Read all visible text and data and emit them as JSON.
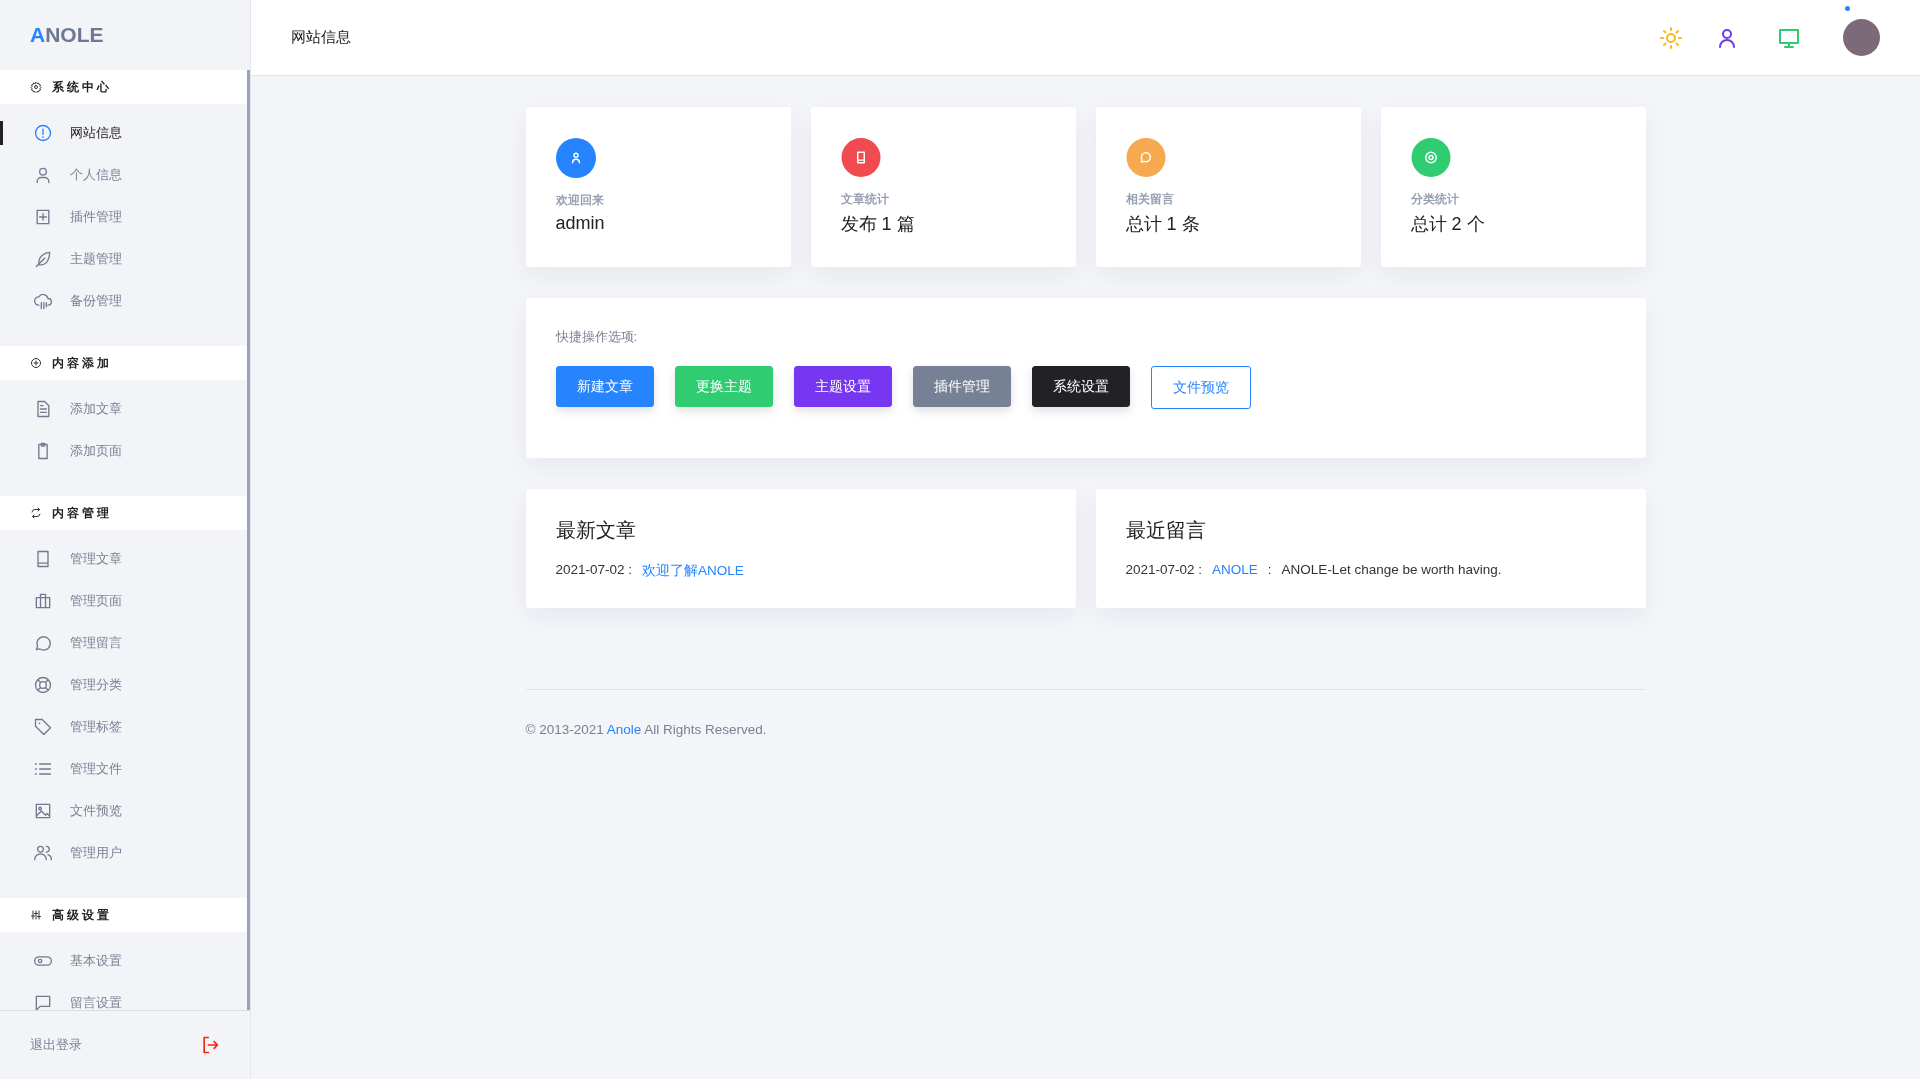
{
  "logo": {
    "accent": "A",
    "rest": "NOLE"
  },
  "sidebar": {
    "sections": [
      {
        "title": "系统中心",
        "items": [
          {
            "label": "网站信息",
            "selected": true
          },
          {
            "label": "个人信息",
            "selected": false
          },
          {
            "label": "插件管理",
            "selected": false
          },
          {
            "label": "主题管理",
            "selected": false
          },
          {
            "label": "备份管理",
            "selected": false
          }
        ]
      },
      {
        "title": "内容添加",
        "items": [
          {
            "label": "添加文章",
            "selected": false
          },
          {
            "label": "添加页面",
            "selected": false
          }
        ]
      },
      {
        "title": "内容管理",
        "items": [
          {
            "label": "管理文章",
            "selected": false
          },
          {
            "label": "管理页面",
            "selected": false
          },
          {
            "label": "管理留言",
            "selected": false
          },
          {
            "label": "管理分类",
            "selected": false
          },
          {
            "label": "管理标签",
            "selected": false
          },
          {
            "label": "管理文件",
            "selected": false
          },
          {
            "label": "文件预览",
            "selected": false
          },
          {
            "label": "管理用户",
            "selected": false
          }
        ]
      },
      {
        "title": "高级设置",
        "items": [
          {
            "label": "基本设置",
            "selected": false
          },
          {
            "label": "留言设置",
            "selected": false
          }
        ]
      }
    ],
    "logout": "退出登录"
  },
  "header": {
    "title": "网站信息"
  },
  "stats": [
    {
      "label": "欢迎回来",
      "value": "admin",
      "color": "#2684ff"
    },
    {
      "label": "文章统计",
      "value": "发布 1 篇",
      "color": "#f04b51"
    },
    {
      "label": "相关留言",
      "value": "总计 1 条",
      "color": "#f7a94f"
    },
    {
      "label": "分类统计",
      "value": "总计 2 个",
      "color": "#2fcc71"
    }
  ],
  "quick": {
    "title": "快捷操作选项:",
    "buttons": [
      {
        "label": "新建文章",
        "kind": "solid",
        "color": "#2684ff"
      },
      {
        "label": "更换主题",
        "kind": "solid",
        "color": "#2fcc71"
      },
      {
        "label": "主题设置",
        "kind": "solid",
        "color": "#7737f0"
      },
      {
        "label": "插件管理",
        "kind": "solid",
        "color": "#778195"
      },
      {
        "label": "系统设置",
        "kind": "solid",
        "color": "#222226"
      },
      {
        "label": "文件预览",
        "kind": "outline",
        "color": "#2684ff"
      }
    ]
  },
  "latest_posts": {
    "title": "最新文章",
    "items": [
      {
        "date": "2021-07-02 :",
        "link": "欢迎了解ANOLE"
      }
    ]
  },
  "recent_comments": {
    "title": "最近留言",
    "items": [
      {
        "date": "2021-07-02 :",
        "author": "ANOLE",
        "sep": ":",
        "text": "ANOLE-Let change be worth having."
      }
    ]
  },
  "footer": {
    "before": "© 2013-2021",
    "link": "Anole",
    "after": "All Rights Reserved."
  }
}
